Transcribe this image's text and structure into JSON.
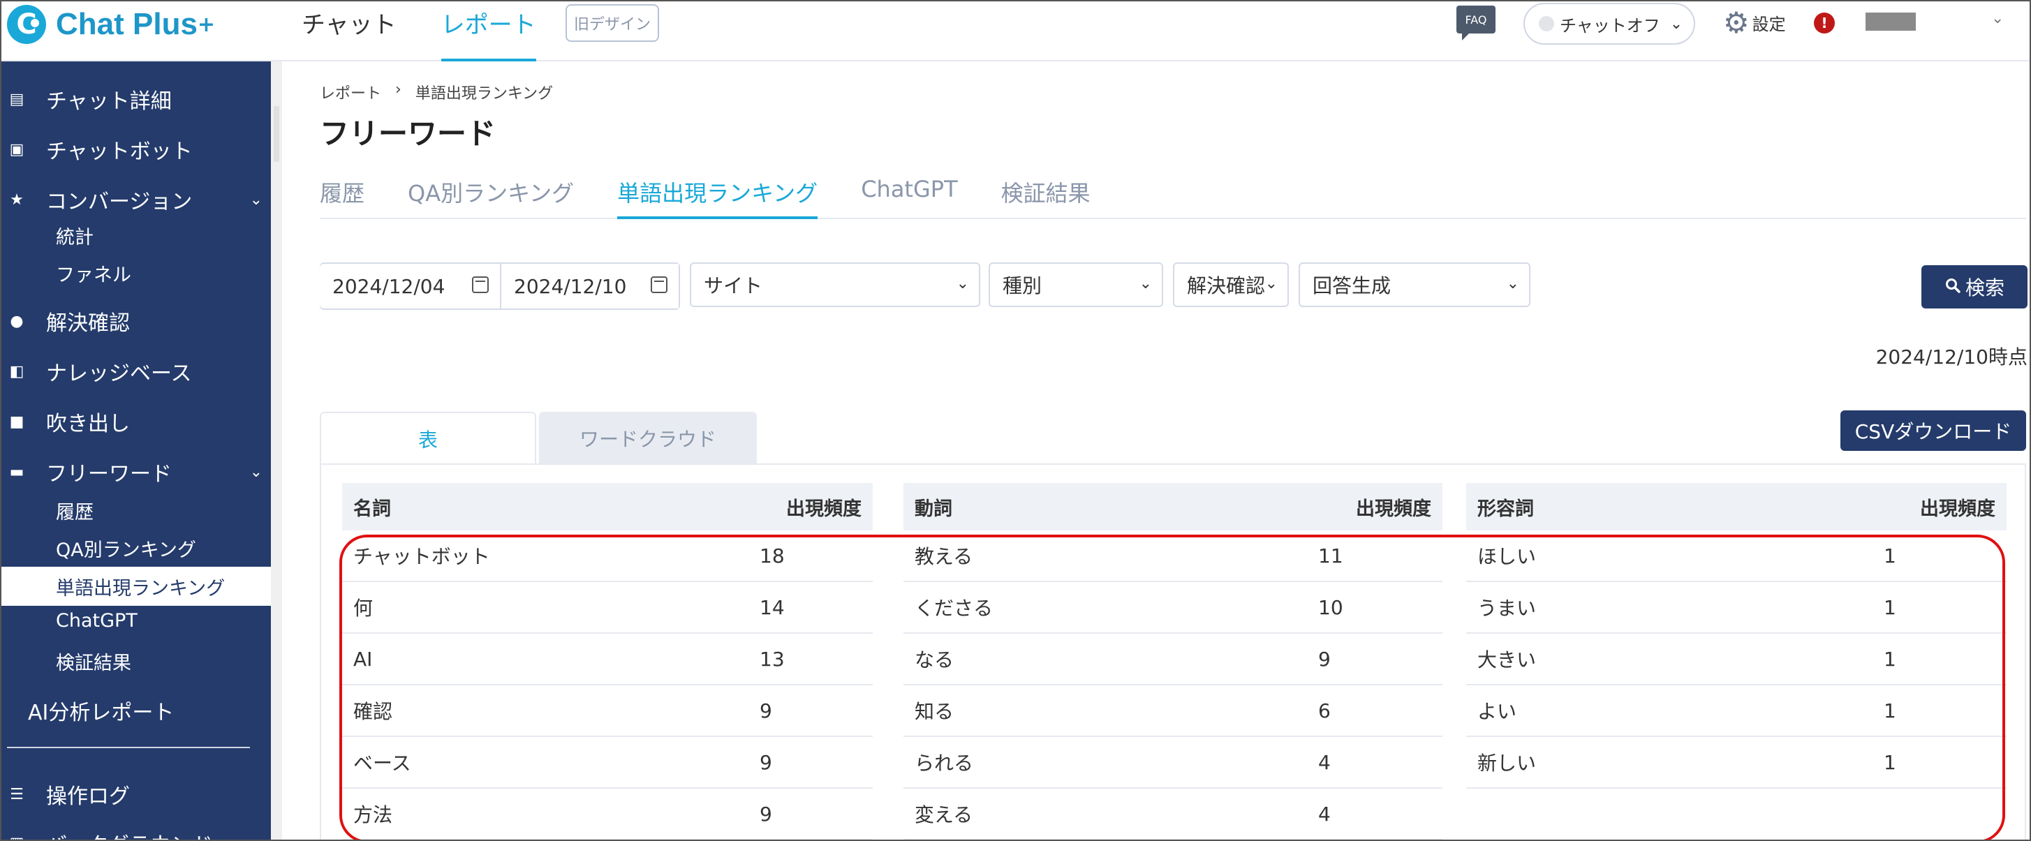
{
  "logo": {
    "text": "Chat Plus",
    "plus": "+"
  },
  "top_nav": [
    {
      "label": "チャット",
      "active": false
    },
    {
      "label": "レポート",
      "active": true
    }
  ],
  "old_design_label": "旧デザイン",
  "faq_label": "FAQ",
  "chat_status": {
    "label": "チャットオフ",
    "chevron": "⌄"
  },
  "settings_label": "設定",
  "alert_label": "!",
  "sidebar": {
    "items": [
      {
        "label": "チャット詳細",
        "icon": "chat-list-icon",
        "glyph": "▤"
      },
      {
        "label": "チャットボット",
        "icon": "chatbot-icon",
        "glyph": "▣"
      },
      {
        "label": "コンバージョン",
        "icon": "star-icon",
        "glyph": "★"
      },
      {
        "label": "解決確認",
        "icon": "bulb-icon",
        "glyph": "●"
      },
      {
        "label": "ナレッジベース",
        "icon": "book-icon",
        "glyph": "◧"
      },
      {
        "label": "吹き出し",
        "icon": "balloon-icon",
        "glyph": "■"
      },
      {
        "label": "フリーワード",
        "icon": "abc-icon",
        "glyph": "▬"
      },
      {
        "label": "操作ログ",
        "icon": "list-icon",
        "glyph": "☰"
      },
      {
        "label": "バックグラウンド",
        "icon": "background-icon",
        "glyph": "▥"
      }
    ],
    "conversion_subs": [
      "統計",
      "ファネル"
    ],
    "freeword_subs": [
      "履歴",
      "QA別ランキング",
      "単語出現ランキング",
      "ChatGPT",
      "検証結果"
    ],
    "ai_report": "AI分析レポート",
    "chevron": "⌄"
  },
  "breadcrumb": {
    "parent": "レポート",
    "separator": "›",
    "current": "単語出現ランキング"
  },
  "page_title": "フリーワード",
  "tabs": [
    {
      "label": "履歴",
      "active": false
    },
    {
      "label": "QA別ランキング",
      "active": false
    },
    {
      "label": "単語出現ランキング",
      "active": true
    },
    {
      "label": "ChatGPT",
      "active": false
    },
    {
      "label": "検証結果",
      "active": false
    }
  ],
  "filters": {
    "date_from": "2024/12/04",
    "date_to": "2024/12/10",
    "site": "サイト",
    "type": "種別",
    "resolution": "解決確認",
    "answer_gen": "回答生成",
    "chevron": "⌄"
  },
  "search_button": {
    "label": "検索",
    "icon": "search-icon"
  },
  "as_of": "2024/12/10時点",
  "view_tabs": [
    {
      "label": "表",
      "active": true
    },
    {
      "label": "ワードクラウド",
      "active": false
    }
  ],
  "csv_button": "CSVダウンロード",
  "tables": {
    "nouns": {
      "header": "名詞",
      "freq_header": "出現頻度",
      "rows": [
        {
          "word": "チャットボット",
          "count": "18"
        },
        {
          "word": "何",
          "count": "14"
        },
        {
          "word": "AI",
          "count": "13"
        },
        {
          "word": "確認",
          "count": "9"
        },
        {
          "word": "ベース",
          "count": "9"
        },
        {
          "word": "方法",
          "count": "9"
        }
      ]
    },
    "verbs": {
      "header": "動詞",
      "freq_header": "出現頻度",
      "rows": [
        {
          "word": "教える",
          "count": "11"
        },
        {
          "word": "くださる",
          "count": "10"
        },
        {
          "word": "なる",
          "count": "9"
        },
        {
          "word": "知る",
          "count": "6"
        },
        {
          "word": "られる",
          "count": "4"
        },
        {
          "word": "変える",
          "count": "4"
        }
      ]
    },
    "adjectives": {
      "header": "形容詞",
      "freq_header": "出現頻度",
      "rows": [
        {
          "word": "ほしい",
          "count": "1"
        },
        {
          "word": "うまい",
          "count": "1"
        },
        {
          "word": "大きい",
          "count": "1"
        },
        {
          "word": "よい",
          "count": "1"
        },
        {
          "word": "新しい",
          "count": "1"
        }
      ]
    }
  },
  "colors": {
    "accent": "#1aa8d8",
    "sidebar": "#243b6b",
    "highlight": "#e01010"
  }
}
